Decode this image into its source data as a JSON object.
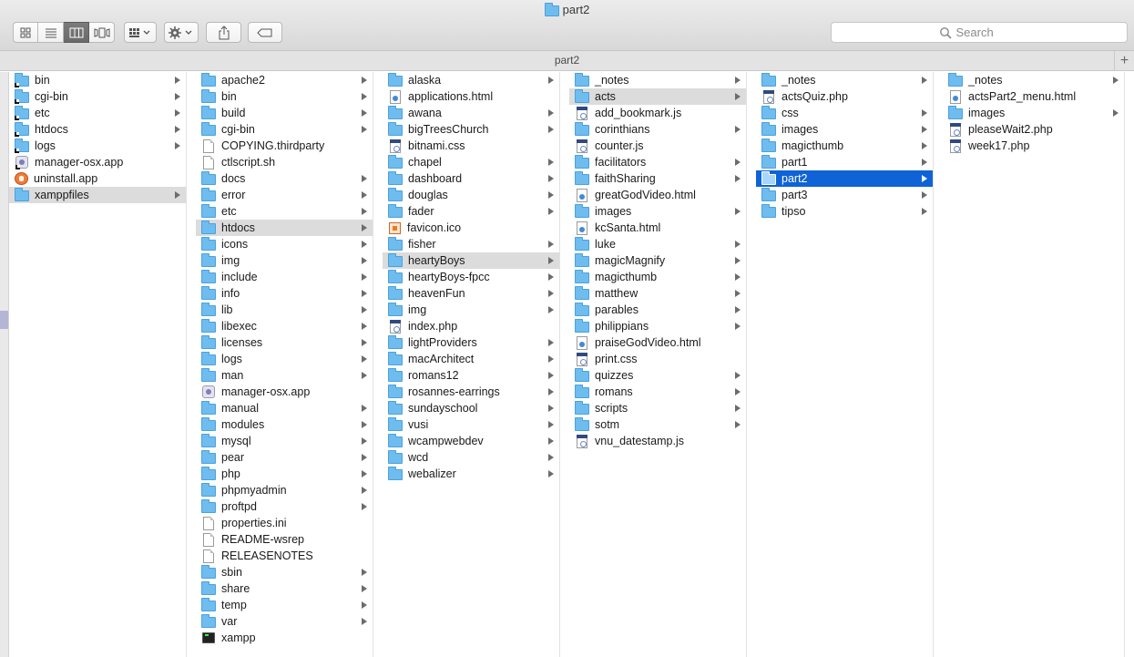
{
  "window": {
    "title": "part2"
  },
  "toolbar": {
    "views": [
      {
        "name": "icon-view-button",
        "icon": "grid-icon"
      },
      {
        "name": "list-view-button",
        "icon": "list-icon"
      },
      {
        "name": "column-view-button",
        "icon": "columns-icon",
        "selected": true
      },
      {
        "name": "coverflow-view-button",
        "icon": "coverflow-icon"
      }
    ],
    "arrange_icon": "arrange-icon",
    "action_icon": "gear-icon",
    "share_icon": "share-icon",
    "tag_icon": "tag-icon"
  },
  "search": {
    "placeholder": "Search"
  },
  "pathbar": {
    "title": "part2"
  },
  "columns": [
    {
      "items": [
        {
          "name": "bin",
          "type": "alias-folder",
          "arrow": true
        },
        {
          "name": "cgi-bin",
          "type": "alias-folder",
          "arrow": true
        },
        {
          "name": "etc",
          "type": "alias-folder",
          "arrow": true
        },
        {
          "name": "htdocs",
          "type": "alias-folder",
          "arrow": true
        },
        {
          "name": "logs",
          "type": "alias-folder",
          "arrow": true
        },
        {
          "name": "manager-osx.app",
          "type": "alias-app"
        },
        {
          "name": "uninstall.app",
          "type": "xampp"
        },
        {
          "name": "xamppfiles",
          "type": "folder",
          "arrow": true,
          "state": "path"
        }
      ]
    },
    {
      "items": [
        {
          "name": "apache2",
          "type": "folder",
          "arrow": true
        },
        {
          "name": "bin",
          "type": "folder",
          "arrow": true
        },
        {
          "name": "build",
          "type": "folder",
          "arrow": true
        },
        {
          "name": "cgi-bin",
          "type": "folder",
          "arrow": true
        },
        {
          "name": "COPYING.thirdparty",
          "type": "doc"
        },
        {
          "name": "ctlscript.sh",
          "type": "doc"
        },
        {
          "name": "docs",
          "type": "folder",
          "arrow": true
        },
        {
          "name": "error",
          "type": "folder",
          "arrow": true
        },
        {
          "name": "etc",
          "type": "folder",
          "arrow": true
        },
        {
          "name": "htdocs",
          "type": "folder",
          "arrow": true,
          "state": "path"
        },
        {
          "name": "icons",
          "type": "folder",
          "arrow": true
        },
        {
          "name": "img",
          "type": "folder",
          "arrow": true
        },
        {
          "name": "include",
          "type": "folder",
          "arrow": true
        },
        {
          "name": "info",
          "type": "folder",
          "arrow": true
        },
        {
          "name": "lib",
          "type": "folder",
          "arrow": true
        },
        {
          "name": "libexec",
          "type": "folder",
          "arrow": true
        },
        {
          "name": "licenses",
          "type": "folder",
          "arrow": true
        },
        {
          "name": "logs",
          "type": "folder",
          "arrow": true
        },
        {
          "name": "man",
          "type": "folder",
          "arrow": true
        },
        {
          "name": "manager-osx.app",
          "type": "app"
        },
        {
          "name": "manual",
          "type": "folder",
          "arrow": true
        },
        {
          "name": "modules",
          "type": "folder",
          "arrow": true
        },
        {
          "name": "mysql",
          "type": "folder",
          "arrow": true
        },
        {
          "name": "pear",
          "type": "folder",
          "arrow": true
        },
        {
          "name": "php",
          "type": "folder",
          "arrow": true
        },
        {
          "name": "phpmyadmin",
          "type": "folder",
          "arrow": true
        },
        {
          "name": "proftpd",
          "type": "folder",
          "arrow": true
        },
        {
          "name": "properties.ini",
          "type": "doc"
        },
        {
          "name": "README-wsrep",
          "type": "doc"
        },
        {
          "name": "RELEASENOTES",
          "type": "doc"
        },
        {
          "name": "sbin",
          "type": "folder",
          "arrow": true
        },
        {
          "name": "share",
          "type": "folder",
          "arrow": true
        },
        {
          "name": "temp",
          "type": "folder",
          "arrow": true
        },
        {
          "name": "var",
          "type": "folder",
          "arrow": true
        },
        {
          "name": "xampp",
          "type": "terminal"
        }
      ]
    },
    {
      "items": [
        {
          "name": "alaska",
          "type": "folder",
          "arrow": true
        },
        {
          "name": "applications.html",
          "type": "web"
        },
        {
          "name": "awana",
          "type": "folder",
          "arrow": true
        },
        {
          "name": "bigTreesChurch",
          "type": "folder",
          "arrow": true
        },
        {
          "name": "bitnami.css",
          "type": "code"
        },
        {
          "name": "chapel",
          "type": "folder",
          "arrow": true
        },
        {
          "name": "dashboard",
          "type": "folder",
          "arrow": true
        },
        {
          "name": "douglas",
          "type": "folder",
          "arrow": true
        },
        {
          "name": "fader",
          "type": "folder",
          "arrow": true
        },
        {
          "name": "favicon.ico",
          "type": "ico"
        },
        {
          "name": "fisher",
          "type": "folder",
          "arrow": true
        },
        {
          "name": "heartyBoys",
          "type": "folder",
          "arrow": true,
          "state": "path"
        },
        {
          "name": "heartyBoys-fpcc",
          "type": "folder",
          "arrow": true
        },
        {
          "name": "heavenFun",
          "type": "folder",
          "arrow": true
        },
        {
          "name": "img",
          "type": "folder",
          "arrow": true
        },
        {
          "name": "index.php",
          "type": "code"
        },
        {
          "name": "lightProviders",
          "type": "folder",
          "arrow": true
        },
        {
          "name": "macArchitect",
          "type": "folder",
          "arrow": true
        },
        {
          "name": "romans12",
          "type": "folder",
          "arrow": true
        },
        {
          "name": "rosannes-earrings",
          "type": "folder",
          "arrow": true
        },
        {
          "name": "sundayschool",
          "type": "folder",
          "arrow": true
        },
        {
          "name": "vusi",
          "type": "folder",
          "arrow": true
        },
        {
          "name": "wcampwebdev",
          "type": "folder",
          "arrow": true
        },
        {
          "name": "wcd",
          "type": "folder",
          "arrow": true
        },
        {
          "name": "webalizer",
          "type": "folder",
          "arrow": true
        }
      ]
    },
    {
      "items": [
        {
          "name": "_notes",
          "type": "folder",
          "arrow": true
        },
        {
          "name": "acts",
          "type": "folder",
          "arrow": true,
          "state": "path"
        },
        {
          "name": "add_bookmark.js",
          "type": "code"
        },
        {
          "name": "corinthians",
          "type": "folder",
          "arrow": true
        },
        {
          "name": "counter.js",
          "type": "code"
        },
        {
          "name": "facilitators",
          "type": "folder",
          "arrow": true
        },
        {
          "name": "faithSharing",
          "type": "folder",
          "arrow": true
        },
        {
          "name": "greatGodVideo.html",
          "type": "web"
        },
        {
          "name": "images",
          "type": "folder",
          "arrow": true
        },
        {
          "name": "kcSanta.html",
          "type": "web"
        },
        {
          "name": "luke",
          "type": "folder",
          "arrow": true
        },
        {
          "name": "magicMagnify",
          "type": "folder",
          "arrow": true
        },
        {
          "name": "magicthumb",
          "type": "folder",
          "arrow": true
        },
        {
          "name": "matthew",
          "type": "folder",
          "arrow": true
        },
        {
          "name": "parables",
          "type": "folder",
          "arrow": true
        },
        {
          "name": "philippians",
          "type": "folder",
          "arrow": true
        },
        {
          "name": "praiseGodVideo.html",
          "type": "web"
        },
        {
          "name": "print.css",
          "type": "code"
        },
        {
          "name": "quizzes",
          "type": "folder",
          "arrow": true
        },
        {
          "name": "romans",
          "type": "folder",
          "arrow": true
        },
        {
          "name": "scripts",
          "type": "folder",
          "arrow": true
        },
        {
          "name": "sotm",
          "type": "folder",
          "arrow": true
        },
        {
          "name": "vnu_datestamp.js",
          "type": "code"
        }
      ]
    },
    {
      "items": [
        {
          "name": "_notes",
          "type": "folder",
          "arrow": true
        },
        {
          "name": "actsQuiz.php",
          "type": "code"
        },
        {
          "name": "css",
          "type": "folder",
          "arrow": true
        },
        {
          "name": "images",
          "type": "folder",
          "arrow": true
        },
        {
          "name": "magicthumb",
          "type": "folder",
          "arrow": true
        },
        {
          "name": "part1",
          "type": "folder",
          "arrow": true
        },
        {
          "name": "part2",
          "type": "folder",
          "arrow": true,
          "state": "selected"
        },
        {
          "name": "part3",
          "type": "folder",
          "arrow": true
        },
        {
          "name": "tipso",
          "type": "folder",
          "arrow": true
        }
      ]
    },
    {
      "items": [
        {
          "name": "_notes",
          "type": "folder",
          "arrow": true
        },
        {
          "name": "actsPart2_menu.html",
          "type": "web"
        },
        {
          "name": "images",
          "type": "folder",
          "arrow": true
        },
        {
          "name": "pleaseWait2.php",
          "type": "code"
        },
        {
          "name": "week17.php",
          "type": "code"
        }
      ]
    }
  ]
}
